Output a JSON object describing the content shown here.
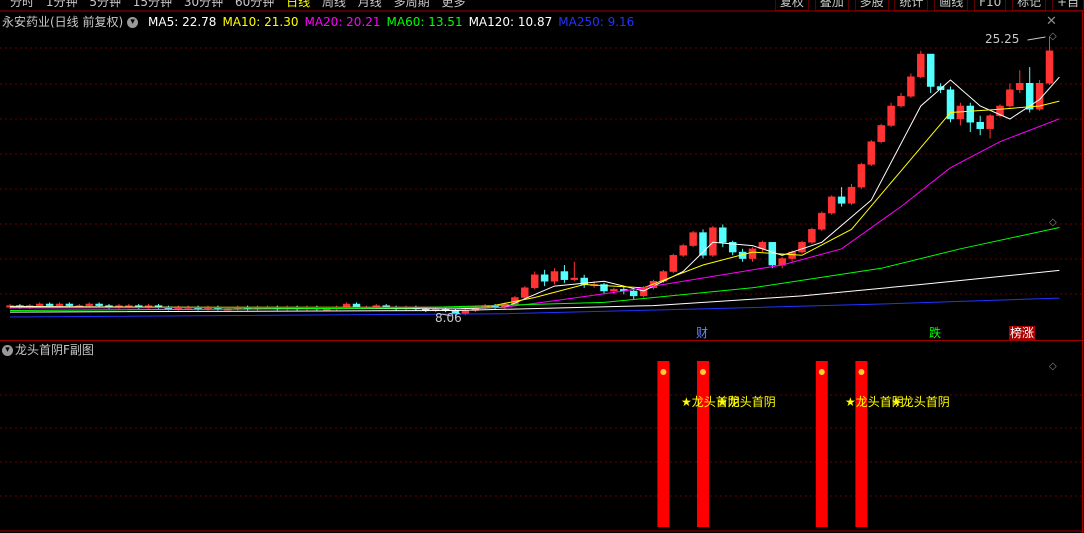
{
  "toolbar": {
    "period_tabs": [
      "分时",
      "1分钟",
      "5分钟",
      "15分钟",
      "30分钟",
      "60分钟",
      "日线",
      "周线",
      "月线",
      "多周期",
      "更多"
    ],
    "active_tab": "日线",
    "buttons": [
      "复权",
      "叠加",
      "多股",
      "统计",
      "画线",
      "F10",
      "标记",
      "+自"
    ]
  },
  "stock": {
    "title": "永安药业(日线 前复权)"
  },
  "ma_legend": [
    {
      "label": "MA5: 22.78",
      "color": "#ffffff"
    },
    {
      "label": "MA10: 21.30",
      "color": "#ffff00"
    },
    {
      "label": "MA20: 20.21",
      "color": "#ff00ff"
    },
    {
      "label": "MA60: 13.51",
      "color": "#00ff00"
    },
    {
      "label": "MA120: 10.87",
      "color": "#ffffff"
    },
    {
      "label": "MA250: 9.16",
      "color": "#2233ff"
    }
  ],
  "price_labels": {
    "high": "25.25",
    "low": "8.06"
  },
  "markers": [
    {
      "text": "财",
      "color": "#6688ff"
    },
    {
      "text": "跌",
      "color": "#00ff00"
    },
    {
      "text": "榜涨",
      "color": "#ffffff",
      "bg": "#aa0000"
    }
  ],
  "sub_chart": {
    "title": "龙头首阴F副图",
    "signal_labels": [
      "★龙头首阴",
      "★龙头首阴",
      "★龙头首阴",
      "★龙头首阴"
    ],
    "label_color": "#ffff00",
    "bar_color": "#ff0000"
  },
  "colors": {
    "up": "#ff3333",
    "down": "#54ffff",
    "grid": "#6a0000"
  },
  "chart_data": {
    "type": "candlestick",
    "y_range": [
      8.06,
      25.25
    ],
    "candles": [
      [
        8.6,
        8.7,
        8.8,
        8.5
      ],
      [
        8.7,
        8.6,
        8.8,
        8.5
      ],
      [
        8.6,
        8.7,
        8.8,
        8.5
      ],
      [
        8.7,
        8.8,
        8.9,
        8.6
      ],
      [
        8.8,
        8.7,
        8.9,
        8.6
      ],
      [
        8.7,
        8.8,
        8.9,
        8.6
      ],
      [
        8.8,
        8.7,
        8.9,
        8.6
      ],
      [
        8.7,
        8.7,
        8.8,
        8.6
      ],
      [
        8.7,
        8.8,
        8.9,
        8.6
      ],
      [
        8.8,
        8.7,
        8.9,
        8.6
      ],
      [
        8.7,
        8.6,
        8.8,
        8.5
      ],
      [
        8.6,
        8.7,
        8.8,
        8.5
      ],
      [
        8.7,
        8.7,
        8.8,
        8.6
      ],
      [
        8.7,
        8.6,
        8.8,
        8.5
      ],
      [
        8.6,
        8.7,
        8.8,
        8.5
      ],
      [
        8.7,
        8.6,
        8.8,
        8.5
      ],
      [
        8.6,
        8.5,
        8.7,
        8.4
      ],
      [
        8.5,
        8.6,
        8.7,
        8.4
      ],
      [
        8.6,
        8.6,
        8.7,
        8.5
      ],
      [
        8.6,
        8.5,
        8.7,
        8.4
      ],
      [
        8.5,
        8.6,
        8.7,
        8.4
      ],
      [
        8.6,
        8.5,
        8.7,
        8.4
      ],
      [
        8.5,
        8.5,
        8.6,
        8.4
      ],
      [
        8.5,
        8.6,
        8.7,
        8.4
      ],
      [
        8.6,
        8.5,
        8.7,
        8.4
      ],
      [
        8.5,
        8.6,
        8.7,
        8.4
      ],
      [
        8.6,
        8.6,
        8.7,
        8.5
      ],
      [
        8.6,
        8.5,
        8.7,
        8.4
      ],
      [
        8.5,
        8.6,
        8.7,
        8.4
      ],
      [
        8.6,
        8.5,
        8.7,
        8.4
      ],
      [
        8.5,
        8.6,
        8.7,
        8.4
      ],
      [
        8.6,
        8.5,
        8.7,
        8.4
      ],
      [
        8.5,
        8.5,
        8.6,
        8.4
      ],
      [
        8.5,
        8.6,
        8.7,
        8.4
      ],
      [
        8.6,
        8.8,
        8.9,
        8.5
      ],
      [
        8.8,
        8.6,
        8.9,
        8.5
      ],
      [
        8.6,
        8.6,
        8.7,
        8.5
      ],
      [
        8.6,
        8.7,
        8.8,
        8.5
      ],
      [
        8.7,
        8.6,
        8.8,
        8.5
      ],
      [
        8.6,
        8.5,
        8.7,
        8.4
      ],
      [
        8.5,
        8.6,
        8.7,
        8.4
      ],
      [
        8.6,
        8.5,
        8.7,
        8.4
      ],
      [
        8.5,
        8.4,
        8.6,
        8.3
      ],
      [
        8.4,
        8.5,
        8.6,
        8.3
      ],
      [
        8.5,
        8.4,
        8.6,
        8.3
      ],
      [
        8.4,
        8.2,
        8.5,
        8.06
      ],
      [
        8.2,
        8.4,
        8.5,
        8.1
      ],
      [
        8.4,
        8.6,
        8.7,
        8.3
      ],
      [
        8.6,
        8.7,
        8.8,
        8.5
      ],
      [
        8.7,
        8.6,
        8.8,
        8.5
      ],
      [
        8.6,
        8.8,
        8.9,
        8.5
      ],
      [
        8.8,
        9.2,
        9.3,
        8.7
      ],
      [
        9.2,
        9.8,
        9.9,
        9.1
      ],
      [
        9.8,
        10.6,
        10.8,
        9.7
      ],
      [
        10.6,
        10.2,
        10.9,
        9.9
      ],
      [
        10.2,
        10.8,
        11.0,
        10.0
      ],
      [
        10.8,
        10.3,
        11.2,
        10.1
      ],
      [
        10.3,
        10.4,
        11.4,
        10.2
      ],
      [
        10.4,
        10.0,
        10.6,
        9.8
      ],
      [
        10.0,
        10.0,
        10.2,
        9.8
      ],
      [
        10.0,
        9.6,
        10.1,
        9.4
      ],
      [
        9.6,
        9.7,
        9.8,
        9.4
      ],
      [
        9.7,
        9.6,
        9.9,
        9.4
      ],
      [
        9.6,
        9.3,
        9.7,
        9.1
      ],
      [
        9.3,
        9.8,
        9.9,
        9.2
      ],
      [
        9.8,
        10.2,
        10.3,
        9.7
      ],
      [
        10.2,
        10.8,
        10.9,
        10.1
      ],
      [
        10.8,
        11.8,
        11.9,
        10.7
      ],
      [
        11.8,
        12.4,
        12.5,
        11.7
      ],
      [
        12.4,
        13.2,
        13.3,
        12.3
      ],
      [
        13.2,
        11.8,
        13.4,
        11.6
      ],
      [
        11.8,
        13.5,
        13.6,
        11.7
      ],
      [
        13.5,
        12.6,
        13.7,
        12.3
      ],
      [
        12.6,
        12.0,
        12.7,
        11.8
      ],
      [
        12.0,
        11.6,
        12.2,
        11.4
      ],
      [
        11.6,
        12.2,
        12.3,
        11.4
      ],
      [
        12.2,
        12.6,
        12.7,
        12.0
      ],
      [
        12.6,
        11.2,
        12.6,
        11.0
      ],
      [
        11.2,
        11.6,
        11.7,
        11.0
      ],
      [
        11.6,
        12.0,
        12.1,
        11.4
      ],
      [
        12.0,
        12.6,
        12.7,
        11.9
      ],
      [
        12.6,
        13.4,
        13.5,
        12.5
      ],
      [
        13.4,
        14.4,
        14.5,
        13.3
      ],
      [
        14.4,
        15.4,
        15.5,
        14.3
      ],
      [
        15.4,
        15.0,
        16.0,
        14.8
      ],
      [
        15.0,
        16.0,
        16.2,
        14.9
      ],
      [
        16.0,
        17.4,
        17.5,
        15.9
      ],
      [
        17.4,
        18.8,
        18.9,
        17.3
      ],
      [
        18.8,
        19.8,
        19.9,
        18.7
      ],
      [
        19.8,
        21.0,
        21.2,
        19.7
      ],
      [
        21.0,
        21.6,
        21.8,
        20.9
      ],
      [
        21.6,
        22.8,
        23.0,
        21.5
      ],
      [
        22.8,
        24.2,
        24.4,
        22.7
      ],
      [
        24.2,
        22.2,
        24.2,
        21.8
      ],
      [
        22.2,
        22.0,
        22.4,
        21.8
      ],
      [
        22.0,
        20.2,
        22.2,
        20.0
      ],
      [
        20.2,
        21.0,
        21.2,
        19.8
      ],
      [
        21.0,
        20.0,
        21.2,
        19.4
      ],
      [
        20.0,
        19.6,
        20.4,
        19.2
      ],
      [
        19.6,
        20.4,
        20.5,
        19.0
      ],
      [
        20.4,
        21.0,
        21.1,
        20.3
      ],
      [
        21.0,
        22.0,
        22.4,
        20.9
      ],
      [
        22.0,
        22.4,
        23.2,
        21.8
      ],
      [
        22.4,
        20.8,
        23.4,
        20.6
      ],
      [
        20.8,
        22.4,
        22.6,
        20.7
      ],
      [
        22.4,
        24.4,
        25.25,
        22.3
      ]
    ],
    "ma": [
      {
        "name": "MA5",
        "color": "#ffffff",
        "points": [
          [
            0,
            8.65
          ],
          [
            45,
            8.5
          ],
          [
            50,
            8.6
          ],
          [
            55,
            9.9
          ],
          [
            60,
            10.2
          ],
          [
            64,
            9.6
          ],
          [
            68,
            10.8
          ],
          [
            71,
            12.6
          ],
          [
            75,
            12.4
          ],
          [
            78,
            11.8
          ],
          [
            82,
            12.6
          ],
          [
            87,
            15.2
          ],
          [
            92,
            21.0
          ],
          [
            95,
            22.6
          ],
          [
            98,
            21.0
          ],
          [
            101,
            20.2
          ],
          [
            104,
            21.4
          ],
          [
            106,
            22.78
          ]
        ]
      },
      {
        "name": "MA10",
        "color": "#ffff00",
        "points": [
          [
            0,
            8.6
          ],
          [
            48,
            8.6
          ],
          [
            53,
            9.2
          ],
          [
            58,
            10.0
          ],
          [
            64,
            9.8
          ],
          [
            70,
            11.2
          ],
          [
            75,
            12.0
          ],
          [
            80,
            11.8
          ],
          [
            85,
            13.4
          ],
          [
            90,
            17.0
          ],
          [
            95,
            20.6
          ],
          [
            100,
            20.8
          ],
          [
            104,
            21.0
          ],
          [
            106,
            21.3
          ]
        ]
      },
      {
        "name": "MA20",
        "color": "#ff00ff",
        "points": [
          [
            0,
            8.55
          ],
          [
            50,
            8.6
          ],
          [
            55,
            9.0
          ],
          [
            62,
            9.6
          ],
          [
            70,
            10.4
          ],
          [
            78,
            11.2
          ],
          [
            84,
            12.2
          ],
          [
            90,
            14.8
          ],
          [
            95,
            17.2
          ],
          [
            100,
            18.8
          ],
          [
            106,
            20.21
          ]
        ]
      },
      {
        "name": "MA60",
        "color": "#00ff00",
        "points": [
          [
            0,
            8.4
          ],
          [
            40,
            8.55
          ],
          [
            60,
            8.9
          ],
          [
            75,
            9.8
          ],
          [
            88,
            11.0
          ],
          [
            96,
            12.2
          ],
          [
            106,
            13.51
          ]
        ]
      },
      {
        "name": "MA120",
        "color": "#ffffff",
        "points": [
          [
            0,
            8.3
          ],
          [
            45,
            8.4
          ],
          [
            65,
            8.7
          ],
          [
            80,
            9.3
          ],
          [
            92,
            10.0
          ],
          [
            106,
            10.87
          ]
        ]
      },
      {
        "name": "MA250",
        "color": "#2233ff",
        "points": [
          [
            0,
            8.0
          ],
          [
            50,
            8.2
          ],
          [
            70,
            8.5
          ],
          [
            88,
            8.8
          ],
          [
            106,
            9.16
          ]
        ]
      }
    ],
    "signal_bars": [
      66,
      70,
      82,
      86
    ]
  }
}
